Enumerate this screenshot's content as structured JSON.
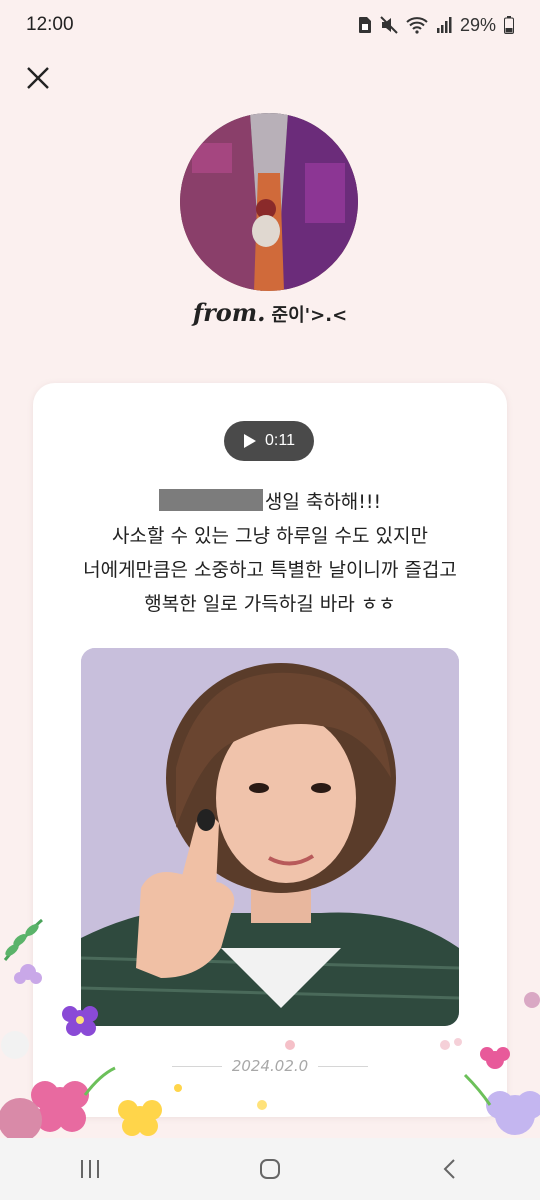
{
  "status_bar": {
    "time": "12:00",
    "battery": "29%",
    "icons": [
      "sim-icon",
      "mute-icon",
      "wifi-icon",
      "signal-icon",
      "battery-icon"
    ]
  },
  "header": {
    "close_icon": "close-icon"
  },
  "sender": {
    "from_prefix": "from.",
    "name": "준이'>.<"
  },
  "message_card": {
    "audio_duration": "0:11",
    "message_line1": "생일 축하해!!!",
    "message_line2": "사소할 수 있는 그냥 하루일 수도 있지만",
    "message_line3": "너에게만큼은 소중하고 특별한 날이니까 즐겁고",
    "message_line4": "행복한 일로 가득하길 바라 ㅎㅎ",
    "date": "2024.02.0"
  },
  "colors": {
    "background": "#fbf0ef",
    "card": "#ffffff",
    "audio_pill": "#4a4a4a",
    "redaction": "#7c7c7c"
  },
  "nav_bar": {
    "icons": [
      "recents-icon",
      "home-icon",
      "back-icon"
    ]
  }
}
